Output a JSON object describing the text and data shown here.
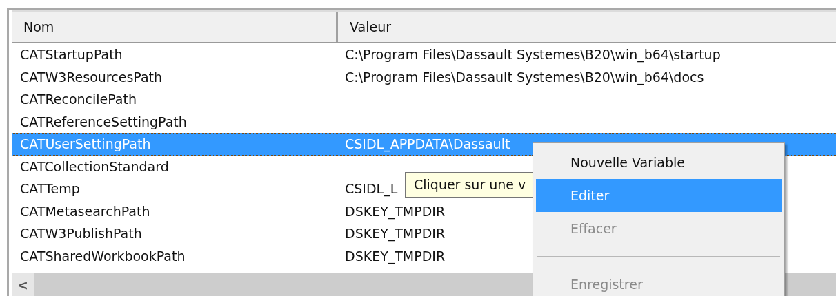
{
  "table": {
    "columns": [
      "Nom",
      "Valeur"
    ],
    "rows": [
      {
        "name": "CATStartupPath",
        "value": "C:\\Program Files\\Dassault Systemes\\B20\\win_b64\\startup",
        "selected": false
      },
      {
        "name": "CATW3ResourcesPath",
        "value": "C:\\Program Files\\Dassault Systemes\\B20\\win_b64\\docs",
        "selected": false
      },
      {
        "name": "CATReconcilePath",
        "selected": false
      },
      {
        "name": "CATReferenceSettingPath",
        "selected": false
      },
      {
        "name": "CATUserSettingPath",
        "value": "CSIDL_APPDATA\\Dassault",
        "selected": true
      },
      {
        "name": "CATCollectionStandard",
        "selected": false
      },
      {
        "name": "CATTemp",
        "value": "CSIDL_L",
        "selected": false
      },
      {
        "name": "CATMetasearchPath",
        "value": "DSKEY_TMPDIR",
        "selected": false
      },
      {
        "name": "CATW3PublishPath",
        "value": "DSKEY_TMPDIR",
        "selected": false
      },
      {
        "name": "CATSharedWorkbookPath",
        "value": "DSKEY_TMPDIR",
        "selected": false
      }
    ],
    "scroll_left_glyph": "<"
  },
  "tooltip": {
    "text": "Cliquer sur une v"
  },
  "context_menu": {
    "items": [
      {
        "kind": "item",
        "label": "Nouvelle Variable",
        "selected": false,
        "disabled": false
      },
      {
        "kind": "item",
        "label": "Editer",
        "selected": true,
        "disabled": false
      },
      {
        "kind": "item",
        "label": "Effacer",
        "selected": false,
        "disabled": true
      },
      {
        "kind": "separator"
      },
      {
        "kind": "item",
        "label": "Enregistrer",
        "selected": false,
        "disabled": true
      }
    ]
  }
}
